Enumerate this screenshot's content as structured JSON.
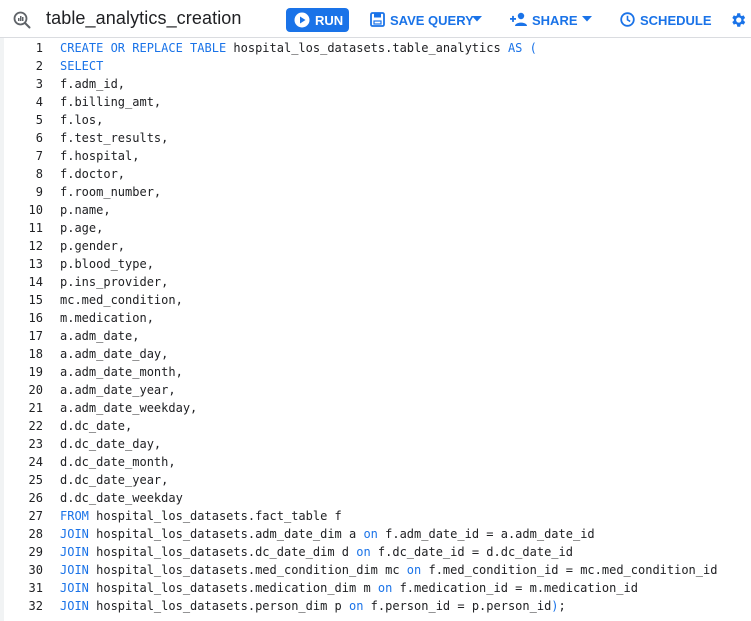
{
  "toolbar": {
    "query_title": "table_analytics_creation",
    "run_label": "RUN",
    "save_label": "SAVE QUERY",
    "share_label": "SHARE",
    "schedule_label": "SCHEDULE",
    "accent_color": "#1a73e8"
  },
  "icons": [
    "query-icon",
    "play-icon",
    "save-icon",
    "chevron-down-icon",
    "add-person-icon",
    "clock-icon",
    "gear-icon"
  ],
  "editor": {
    "lines": [
      {
        "n": "1",
        "t": [
          [
            "kw",
            "CREATE OR REPLACE TABLE"
          ],
          [
            "p",
            " hospital_los_datasets.table_analytics "
          ],
          [
            "kw",
            "AS ("
          ]
        ]
      },
      {
        "n": "2",
        "t": [
          [
            "kw",
            "SELECT"
          ]
        ]
      },
      {
        "n": "3",
        "t": [
          [
            "p",
            "f.adm_id,"
          ]
        ]
      },
      {
        "n": "4",
        "t": [
          [
            "p",
            "f.billing_amt,"
          ]
        ]
      },
      {
        "n": "5",
        "t": [
          [
            "p",
            "f.los,"
          ]
        ]
      },
      {
        "n": "6",
        "t": [
          [
            "p",
            "f.test_results,"
          ]
        ]
      },
      {
        "n": "7",
        "t": [
          [
            "p",
            "f.hospital,"
          ]
        ]
      },
      {
        "n": "8",
        "t": [
          [
            "p",
            "f.doctor,"
          ]
        ]
      },
      {
        "n": "9",
        "t": [
          [
            "p",
            "f.room_number,"
          ]
        ]
      },
      {
        "n": "10",
        "t": [
          [
            "p",
            "p.name,"
          ]
        ]
      },
      {
        "n": "11",
        "t": [
          [
            "p",
            "p.age,"
          ]
        ]
      },
      {
        "n": "12",
        "t": [
          [
            "p",
            "p.gender,"
          ]
        ]
      },
      {
        "n": "13",
        "t": [
          [
            "p",
            "p.blood_type,"
          ]
        ]
      },
      {
        "n": "14",
        "t": [
          [
            "p",
            "p.ins_provider,"
          ]
        ]
      },
      {
        "n": "15",
        "t": [
          [
            "p",
            "mc.med_condition,"
          ]
        ]
      },
      {
        "n": "16",
        "t": [
          [
            "p",
            "m.medication,"
          ]
        ]
      },
      {
        "n": "17",
        "t": [
          [
            "p",
            "a.adm_date,"
          ]
        ]
      },
      {
        "n": "18",
        "t": [
          [
            "p",
            "a.adm_date_day,"
          ]
        ]
      },
      {
        "n": "19",
        "t": [
          [
            "p",
            "a.adm_date_month,"
          ]
        ]
      },
      {
        "n": "20",
        "t": [
          [
            "p",
            "a.adm_date_year,"
          ]
        ]
      },
      {
        "n": "21",
        "t": [
          [
            "p",
            "a.adm_date_weekday,"
          ]
        ]
      },
      {
        "n": "22",
        "t": [
          [
            "p",
            "d.dc_date,"
          ]
        ]
      },
      {
        "n": "23",
        "t": [
          [
            "p",
            "d.dc_date_day,"
          ]
        ]
      },
      {
        "n": "24",
        "t": [
          [
            "p",
            "d.dc_date_month,"
          ]
        ]
      },
      {
        "n": "25",
        "t": [
          [
            "p",
            "d.dc_date_year,"
          ]
        ]
      },
      {
        "n": "26",
        "t": [
          [
            "p",
            "d.dc_date_weekday"
          ]
        ]
      },
      {
        "n": "27",
        "t": [
          [
            "kw",
            "FROM"
          ],
          [
            "p",
            " hospital_los_datasets.fact_table f"
          ]
        ]
      },
      {
        "n": "28",
        "t": [
          [
            "kw",
            "JOIN"
          ],
          [
            "p",
            " hospital_los_datasets.adm_date_dim a "
          ],
          [
            "kw",
            "on"
          ],
          [
            "p",
            " f.adm_date_id = a.adm_date_id"
          ]
        ]
      },
      {
        "n": "29",
        "t": [
          [
            "kw",
            "JOIN"
          ],
          [
            "p",
            " hospital_los_datasets.dc_date_dim d "
          ],
          [
            "kw",
            "on"
          ],
          [
            "p",
            " f.dc_date_id = d.dc_date_id"
          ]
        ]
      },
      {
        "n": "30",
        "t": [
          [
            "kw",
            "JOIN"
          ],
          [
            "p",
            " hospital_los_datasets.med_condition_dim mc "
          ],
          [
            "kw",
            "on"
          ],
          [
            "p",
            " f.med_condition_id = mc.med_condition_id"
          ]
        ]
      },
      {
        "n": "31",
        "t": [
          [
            "kw",
            "JOIN"
          ],
          [
            "p",
            " hospital_los_datasets.medication_dim m "
          ],
          [
            "kw",
            "on"
          ],
          [
            "p",
            " f.medication_id = m.medication_id"
          ]
        ]
      },
      {
        "n": "32",
        "t": [
          [
            "kw",
            "JOIN"
          ],
          [
            "p",
            " hospital_los_datasets.person_dim p "
          ],
          [
            "kw",
            "on"
          ],
          [
            "p",
            " f.person_id = p.person_id"
          ],
          [
            "kw",
            ")"
          ],
          [
            "p",
            ";"
          ]
        ]
      }
    ]
  }
}
